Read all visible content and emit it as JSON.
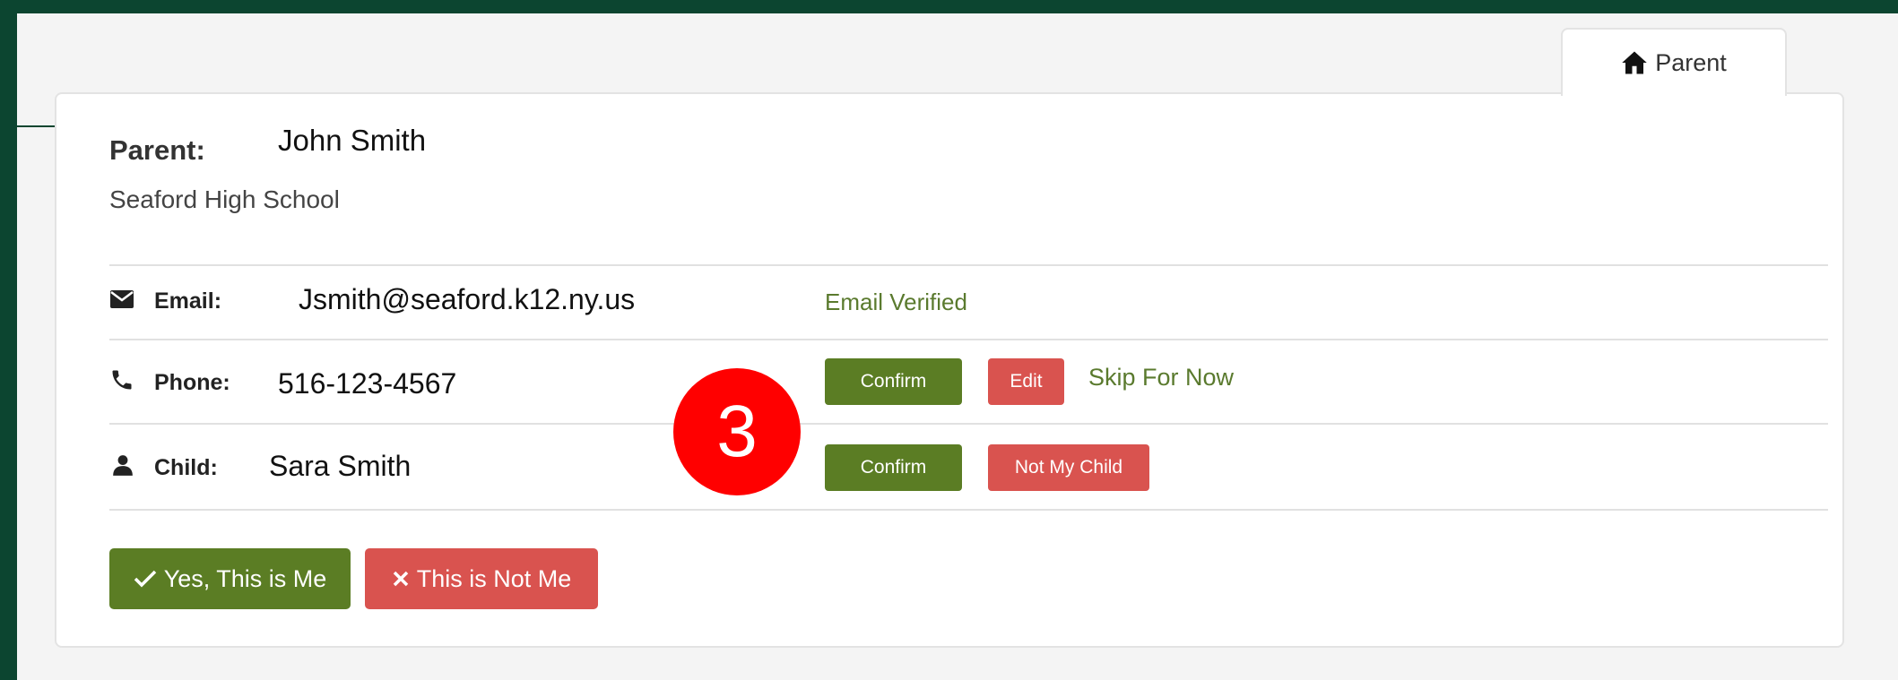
{
  "tab": {
    "icon": "home-icon",
    "label": "Parent"
  },
  "parent": {
    "label": "Parent:",
    "name": "John Smith",
    "school": "Seaford High School"
  },
  "email": {
    "icon": "envelope-icon",
    "label": "Email:",
    "value": "Jsmith@seaford.k12.ny.us",
    "status": "Email Verified"
  },
  "phone": {
    "icon": "phone-icon",
    "label": "Phone:",
    "value": "516-123-4567",
    "confirm": "Confirm",
    "edit": "Edit",
    "skip": "Skip For Now"
  },
  "child": {
    "icon": "user-icon",
    "label": "Child:",
    "value": "Sara Smith",
    "confirm": "Confirm",
    "not_mine": "Not My Child"
  },
  "actions": {
    "yes": "Yes, This is Me",
    "no": "This is Not Me"
  },
  "badge": {
    "text": "3"
  },
  "colors": {
    "green": "#5b7d24",
    "red": "#d9534f",
    "frame": "#0c4530",
    "badge": "#ff0000"
  }
}
